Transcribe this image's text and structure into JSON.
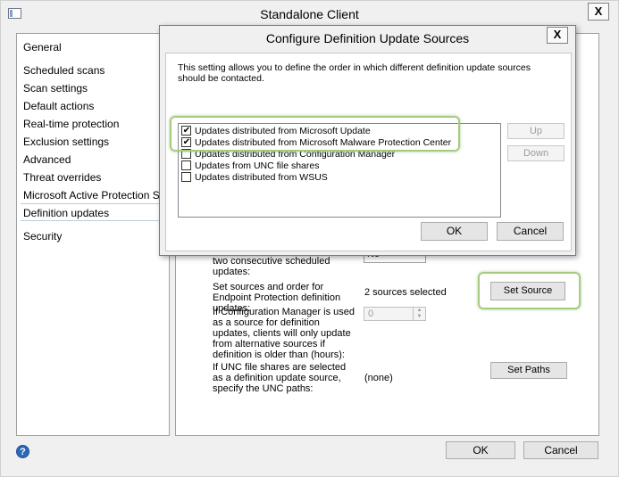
{
  "window": {
    "title": "Standalone Client",
    "close_glyph": "X"
  },
  "nav": {
    "items": [
      {
        "label": "General"
      },
      {
        "label": "Scheduled scans"
      },
      {
        "label": "Scan settings"
      },
      {
        "label": "Default actions"
      },
      {
        "label": "Real-time protection"
      },
      {
        "label": "Exclusion settings"
      },
      {
        "label": "Advanced"
      },
      {
        "label": "Threat overrides"
      },
      {
        "label": "Microsoft Active Protection Service"
      },
      {
        "label": "Definition updates"
      },
      {
        "label": "Security"
      }
    ],
    "selected": "Definition updates"
  },
  "panel": {
    "offline_label": "computer is offline for more than two consecutive scheduled updates:",
    "offline_value": "No",
    "sources_label": "Set sources and order for Endpoint Protection definition updates:",
    "sources_value": "2 sources selected",
    "set_source_label": "Set Source",
    "cm_label": "If Configuration Manager is used as a source for definition updates, clients will only update from alternative sources if definition is older than (hours):",
    "cm_value": "0",
    "unc_label": "If UNC file shares are selected as a definition update source, specify the UNC paths:",
    "unc_value": "(none)",
    "set_paths_label": "Set Paths"
  },
  "footer": {
    "ok_label": "OK",
    "cancel_label": "Cancel",
    "help_glyph": "?"
  },
  "dialog": {
    "title": "Configure Definition Update Sources",
    "close_glyph": "X",
    "description": "This setting allows you to define the order in which different definition update sources should be contacted.",
    "sources": [
      {
        "label": "Updates distributed from Microsoft Update",
        "checked": true
      },
      {
        "label": "Updates distributed from Microsoft Malware Protection Center",
        "checked": true
      },
      {
        "label": "Updates distributed from Configuration Manager",
        "checked": false
      },
      {
        "label": "Updates from UNC file shares",
        "checked": false
      },
      {
        "label": "Updates distributed from WSUS",
        "checked": false
      }
    ],
    "up_label": "Up",
    "down_label": "Down",
    "ok_label": "OK",
    "cancel_label": "Cancel"
  },
  "colors": {
    "highlight": "#a6cb80",
    "help_blue": "#2b68b8"
  }
}
